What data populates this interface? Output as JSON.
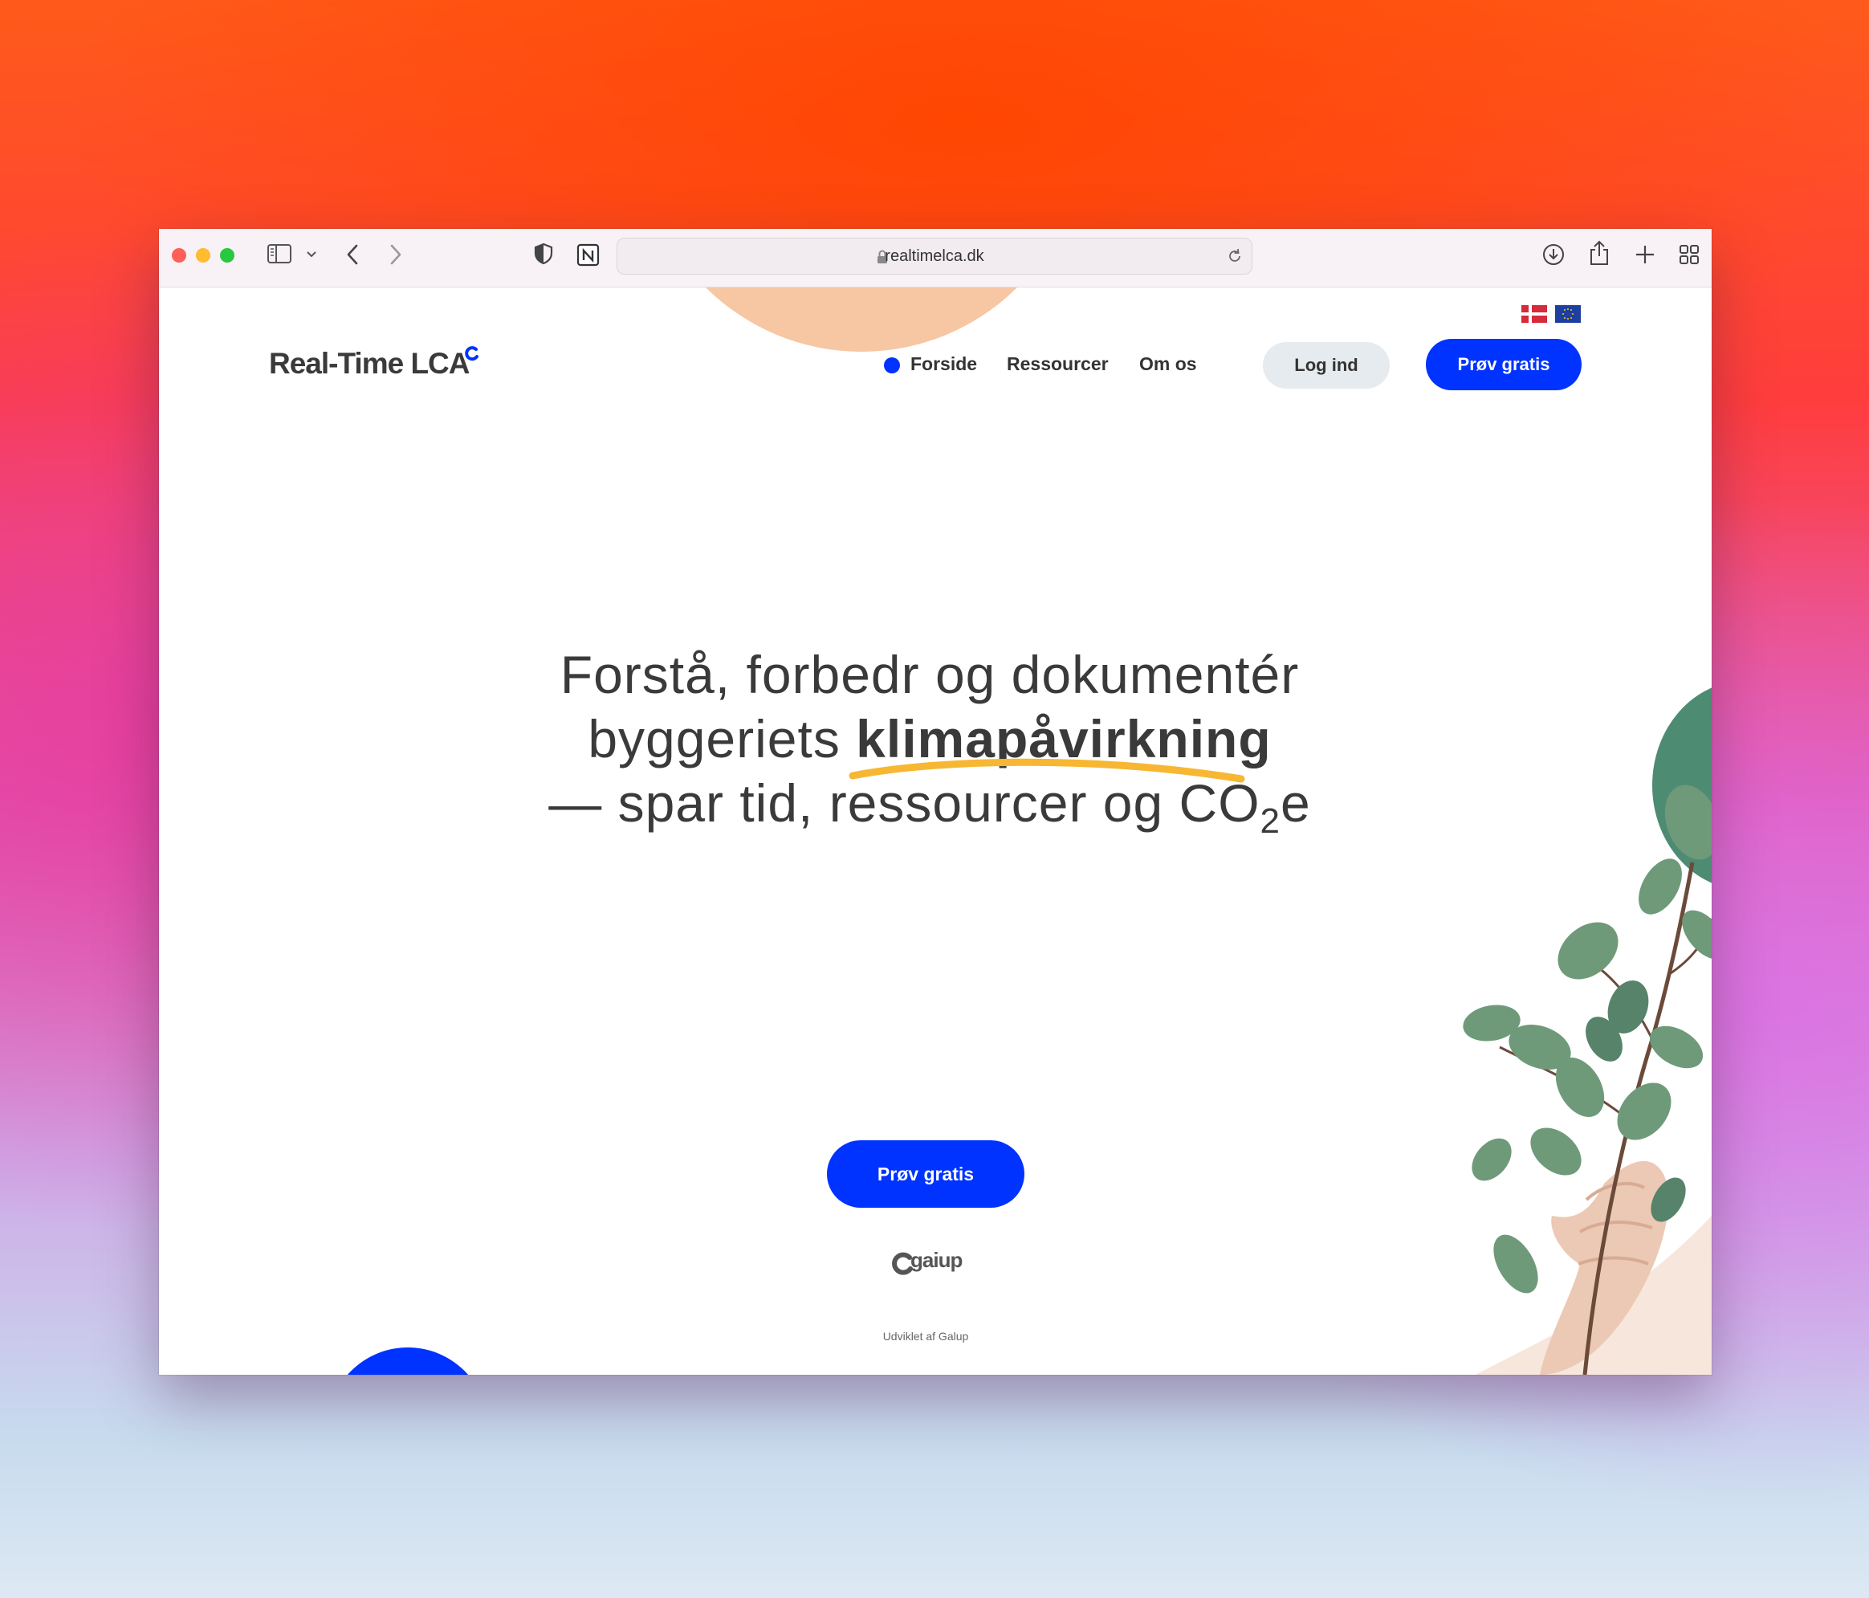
{
  "browser": {
    "url": "realtimelca.dk",
    "icons": [
      "sidebar-icon",
      "chevron-down-icon",
      "back-icon",
      "forward-icon",
      "shield-icon",
      "notion-icon",
      "lock-icon",
      "reload-icon",
      "download-icon",
      "share-icon",
      "new-tab-icon",
      "tab-overview-icon"
    ]
  },
  "site": {
    "logo_text": "Real-Time LCA",
    "languages": [
      "Dansk",
      "EU"
    ],
    "nav": {
      "items": [
        "Forside",
        "Ressourcer",
        "Om os"
      ],
      "login": "Log ind",
      "cta": "Prøv gratis"
    },
    "hero": {
      "line1": "Forstå, forbedr og dokumentér",
      "line2_prefix": "byggeriets ",
      "line2_strong": "klimapåvirkning",
      "line3_prefix": "— spar tid, ressourcer og CO",
      "line3_sub": "2",
      "line3_suffix": "e",
      "cta": "Prøv gratis"
    },
    "partner": {
      "name": "gaiup",
      "caption": "Udviklet af Galup"
    }
  },
  "colors": {
    "accent": "#0033ff",
    "highlight": "#f7b733",
    "peach": "#f7c6a3",
    "green": "#4e8b73",
    "text": "#3a3a3a"
  }
}
